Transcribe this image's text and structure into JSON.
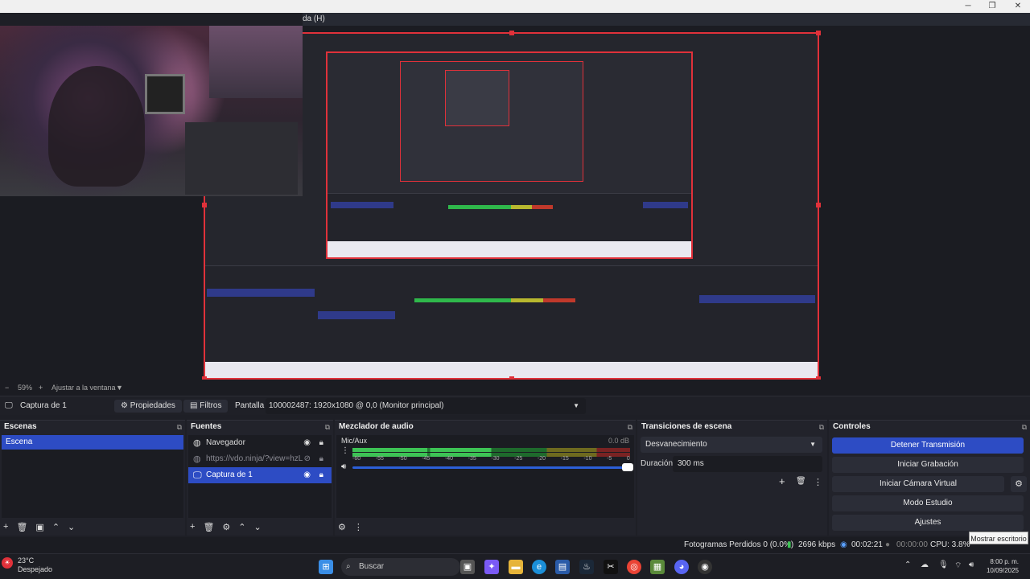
{
  "window": {
    "menu_tail": "da (H)",
    "min": "─",
    "max": "❐",
    "close": "✕"
  },
  "preview": {
    "zoom": "59%",
    "zoom_plus": "+",
    "fit_label": "Ajustar a la ventana",
    "fit_caret": "▼",
    "zoom_minus": "−"
  },
  "source_toolbar": {
    "source_name": "Captura de 1",
    "properties": "Propiedades",
    "filters": "Filtros",
    "display_label": "Pantalla",
    "display_value": "100002487: 1920x1080 @ 0,0 (Monitor principal)"
  },
  "scenes": {
    "title": "Escenas",
    "items": [
      "Escena"
    ]
  },
  "sources": {
    "title": "Fuentes",
    "items": [
      {
        "name": "Navegador",
        "icon": "globe-icon"
      },
      {
        "name": "https://vdo.ninja/?view=hzLC…",
        "icon": "globe-icon"
      },
      {
        "name": "Captura de 1",
        "icon": "monitor-icon"
      }
    ]
  },
  "mixer": {
    "title": "Mezclador de audio",
    "channel": "Mic/Aux",
    "db": "0.0 dB",
    "ticks": [
      "-60",
      "-55",
      "-50",
      "-45",
      "-40",
      "-35",
      "-30",
      "-25",
      "-20",
      "-15",
      "-10",
      "-5",
      "0"
    ],
    "volume": 1.0
  },
  "transitions": {
    "title": "Transiciones de escena",
    "selected": "Desvanecimiento",
    "duration_label": "Duración",
    "duration_value": "300 ms"
  },
  "controls": {
    "title": "Controles",
    "stop_stream": "Detener Transmisión",
    "start_recording": "Iniciar Grabación",
    "start_virtual_cam": "Iniciar Cámara Virtual",
    "studio_mode": "Modo Estudio",
    "settings": "Ajustes"
  },
  "status": {
    "dropped": "Fotogramas Perdidos 0 (0.0%)",
    "bitrate": "2696 kbps",
    "stream_time": "00:02:21",
    "rec_time": "00:00:00",
    "cpu": "CPU: 3.8%"
  },
  "tooltip": "Mostrar escritorio",
  "taskbar": {
    "temp": "23°C",
    "weather": "Despejado",
    "search": "Buscar",
    "time": "8:00 p. m.",
    "date": "10/09/2025"
  },
  "colors": {
    "accent": "#2d4cc4",
    "selection_border": "#e0313a",
    "meter_green": "#3dc355"
  }
}
